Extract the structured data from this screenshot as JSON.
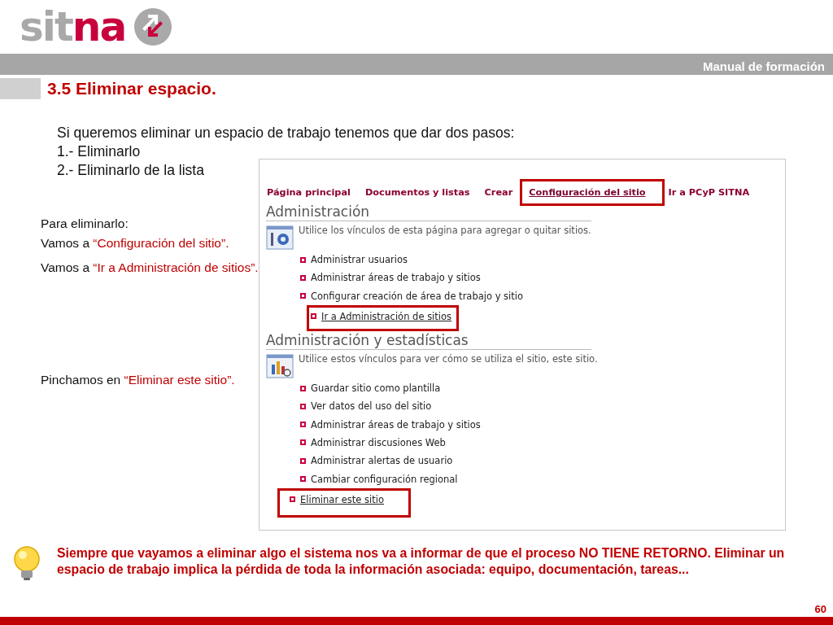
{
  "logo": {
    "lead": "sit",
    "accent": "na"
  },
  "banner": "Manual de formación",
  "title": "3.5 Eliminar espacio.",
  "intro": [
    "Si queremos eliminar un espacio de trabajo tenemos que dar dos pasos:",
    "1.- Eliminarlo",
    "2.- Eliminarlo de la lista"
  ],
  "notes": [
    {
      "lead": "Para eliminarlo:"
    },
    {
      "lead": "Vamos a ",
      "link": "“Configuración del sitio”."
    },
    {
      "lead": "Vamos a ",
      "link": "“Ir a Administración de sitios”."
    },
    {
      "lead": "Pinchamos en ",
      "link": "“Eliminar este sitio”."
    }
  ],
  "screenshot": {
    "nav": [
      {
        "label": "Página principal",
        "highlighted": false
      },
      {
        "label": "Documentos y listas",
        "highlighted": false
      },
      {
        "label": "Crear",
        "highlighted": false
      },
      {
        "label": "Configuración del sitio",
        "highlighted": true
      },
      {
        "label": "Ir a PCyP SITNA",
        "highlighted": false
      }
    ],
    "sections": [
      {
        "title": "Administración",
        "kind": "admin",
        "description": "Utilice los vínculos de esta página para agregar o quitar sitios.",
        "links": [
          {
            "label": "Administrar usuarios",
            "highlighted": false
          },
          {
            "label": "Administrar áreas de trabajo y sitios",
            "highlighted": false
          },
          {
            "label": "Configurar creación de área de trabajo y sitio",
            "highlighted": false
          },
          {
            "label": "Ir a Administración de sitios",
            "highlighted": true
          }
        ]
      },
      {
        "title": "Administración y estadísticas",
        "kind": "stats",
        "description": "Utilice estos vínculos para ver cómo se utiliza el sitio, este sitio.",
        "links": [
          {
            "label": "Guardar sitio como plantilla",
            "highlighted": false
          },
          {
            "label": "Ver datos del uso del sitio",
            "highlighted": false
          },
          {
            "label": "Administrar áreas de trabajo y sitios",
            "highlighted": false
          },
          {
            "label": "Administrar discusiones Web",
            "highlighted": false
          },
          {
            "label": "Administrar alertas de usuario",
            "highlighted": false
          },
          {
            "label": "Cambiar configuración regional",
            "highlighted": false
          },
          {
            "label": "Eliminar este sitio",
            "highlighted": true
          }
        ]
      }
    ]
  },
  "callout": "Siempre que vayamos a eliminar algo el sistema nos va a informar de que el proceso NO TIENE RETORNO. Eliminar un espacio de trabajo implica la pérdida de toda la información asociada: equipo, documentación, tareas...",
  "page_number": "60"
}
